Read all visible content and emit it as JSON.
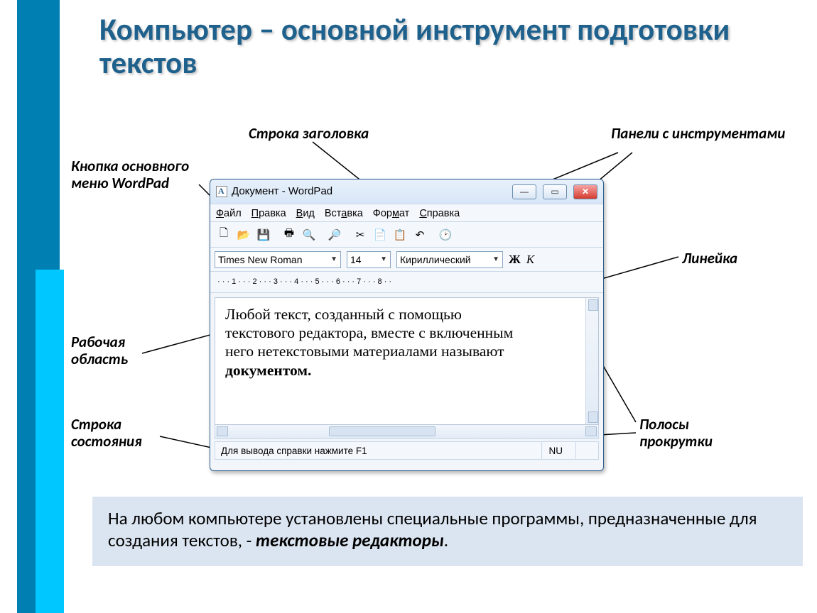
{
  "slide": {
    "title": "Компьютер – основной инструмент подготовки текстов"
  },
  "labels": {
    "title_bar": "Строка заголовка",
    "toolbars": "Панели с инструментами",
    "main_menu": "Кнопка основного меню WordPad",
    "ruler": "Линейка",
    "work_area": "Рабочая область",
    "status_bar": "Строка состояния",
    "scrollbars": "Полосы прокрутки"
  },
  "bottom_paragraph": {
    "text_1": "На любом компьютере установлены специальные программы, предназначенные для создания текстов, - ",
    "emph": "текстовые редакторы",
    "text_2": "."
  },
  "wordpad": {
    "window_title": "Документ - WordPad",
    "menu": [
      "Файл",
      "Правка",
      "Вид",
      "Вставка",
      "Формат",
      "Справка"
    ],
    "font_name": "Times New Roman",
    "font_size": "14",
    "charset": "Кириллический",
    "bold_label": "Ж",
    "italic_label": "К",
    "ruler_text": "· · · 1 · · · 2 · · · 3 · · · 4 · · · 5 · · · 6 · · · 7 · · · 8 · ·",
    "body_line1": "     Любой текст, созданный с помощью",
    "body_line2": "текстового редактора, вместе с включенным",
    "body_line3": "него нетекстовыми материалами называют",
    "body_line4": "документом.",
    "status_text": "Для вывода справки нажмите F1",
    "status_ind": "NU"
  }
}
